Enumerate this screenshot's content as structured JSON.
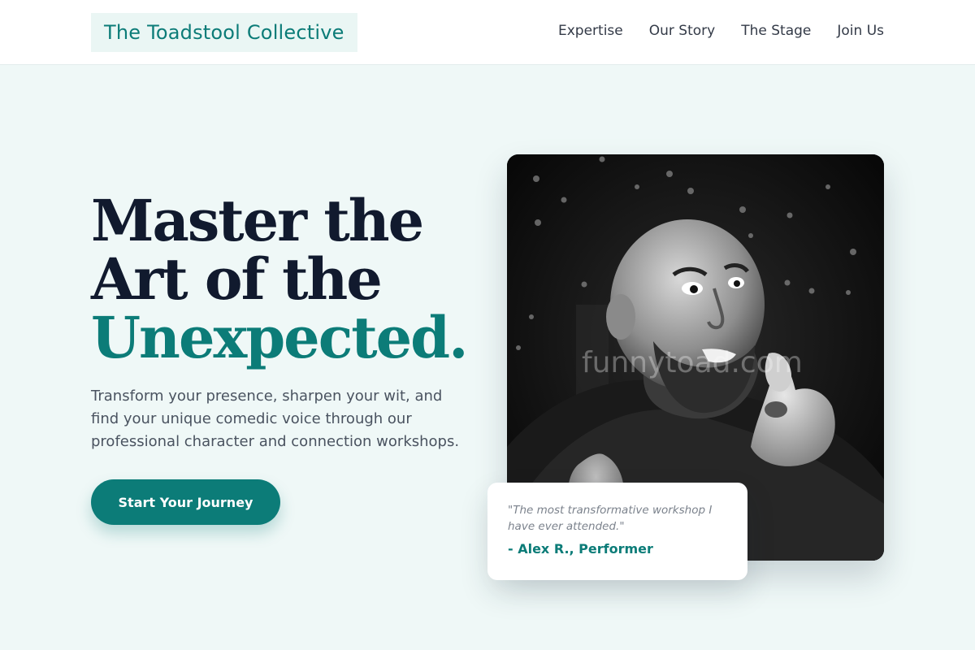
{
  "header": {
    "brand": "The Toadstool Collective",
    "nav": [
      {
        "label": "Expertise"
      },
      {
        "label": "Our Story"
      },
      {
        "label": "The Stage"
      },
      {
        "label": "Join Us"
      }
    ]
  },
  "hero": {
    "heading_line1": "Master the",
    "heading_line2": "Art of the",
    "heading_line3": "Unexpected.",
    "subtitle": "Transform your presence, sharpen your wit, and find your unique comedic voice through our professional character and connection workshops.",
    "cta_label": "Start Your Journey"
  },
  "image": {
    "watermark": "funnytoad.com",
    "subject": "bald bearded man pointing with thumbs up, black and white photo"
  },
  "testimonial": {
    "quote": "\"The most transformative workshop I have ever attended.\"",
    "author": "- Alex R., Performer"
  },
  "colors": {
    "accent": "#0c7c78",
    "background": "#eff8f7",
    "heading": "#111a2e"
  }
}
